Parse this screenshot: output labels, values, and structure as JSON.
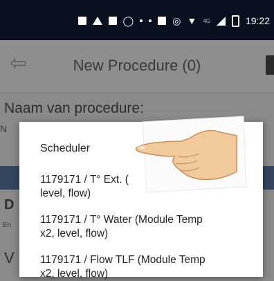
{
  "status_bar": {
    "clock": "19:22",
    "network_label": "4G",
    "icons": [
      "notification-icon",
      "alert-icon",
      "message-icon",
      "whatsapp-icon",
      "nfc-icon",
      "vibrate-icon",
      "wifi-icon",
      "signal-icon",
      "battery-icon"
    ]
  },
  "app_bar": {
    "title": "New Procedure (0)",
    "back_icon": "back-arrow-icon",
    "delete_icon": "trash-icon"
  },
  "background": {
    "name_label": "Naam van procedure:",
    "name_value_partial": "N",
    "section_d_partial": "D",
    "section_en_partial": "En",
    "section_v_partial": "V"
  },
  "dialog": {
    "title": "Scheduler",
    "options": [
      {
        "line1": "1179171 / T° Ext. (",
        "line1_tail": "2,",
        "line2": "level, flow)"
      },
      {
        "line1": "1179171 / T° Water (Module Temp",
        "line2": "x2, level, flow)"
      },
      {
        "line1": "1179171 / Flow TLF (Module Temp",
        "line2": "x2, level, flow)"
      }
    ]
  },
  "colors": {
    "status_bar": "#0b1020",
    "overlay_gray": "#8a8a8a",
    "blue_band": "#34465e",
    "dialog_bg": "#ffffff"
  }
}
